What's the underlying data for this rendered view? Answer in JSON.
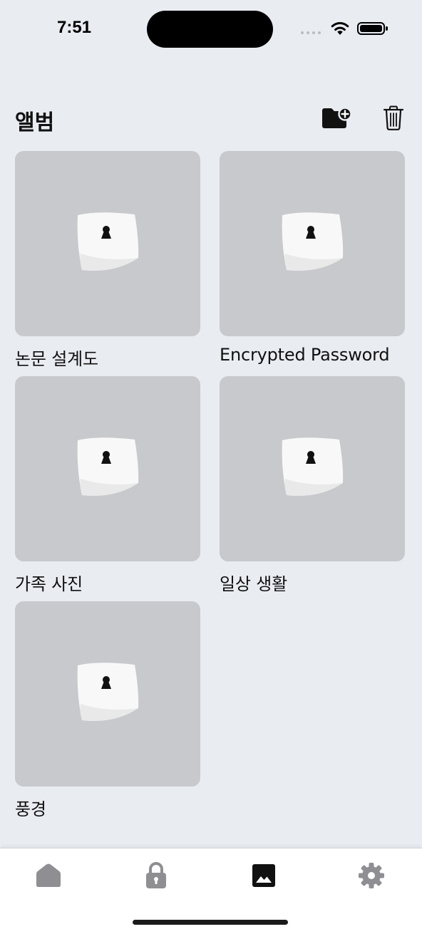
{
  "status_bar": {
    "time": "7:51"
  },
  "header": {
    "title": "앨범",
    "new_folder_icon": "folder-plus-icon",
    "trash_icon": "trash-icon"
  },
  "albums": [
    {
      "name": "논문 설계도",
      "thumbnail_icon": "locked-safe-icon"
    },
    {
      "name": "Encrypted Password",
      "thumbnail_icon": "locked-safe-icon"
    },
    {
      "name": "가족 사진",
      "thumbnail_icon": "locked-safe-icon"
    },
    {
      "name": "일상 생활",
      "thumbnail_icon": "locked-safe-icon"
    },
    {
      "name": "풍경",
      "thumbnail_icon": "locked-safe-icon"
    }
  ],
  "tab_bar": {
    "tabs": [
      {
        "icon": "home-icon",
        "selected": false
      },
      {
        "icon": "lock-icon",
        "selected": false
      },
      {
        "icon": "photo-icon",
        "selected": true
      },
      {
        "icon": "gear-icon",
        "selected": false
      }
    ],
    "colors": {
      "active": "#111111",
      "inactive": "#8e8e93"
    }
  },
  "colors": {
    "background": "#e9ecf1",
    "thumbnail": "#c8c9cd"
  }
}
